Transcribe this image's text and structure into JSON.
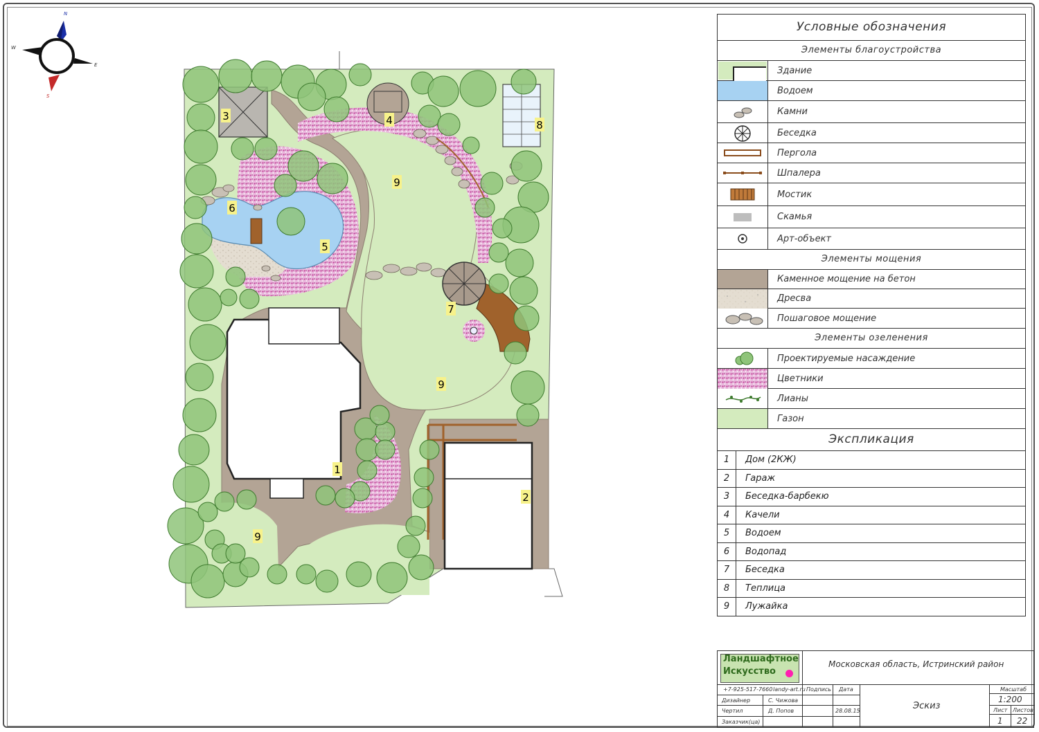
{
  "compass": {
    "n": "N",
    "s": "S",
    "w": "W",
    "e": "E"
  },
  "plan_labels": [
    "1",
    "2",
    "3",
    "4",
    "5",
    "6",
    "7",
    "8",
    "9"
  ],
  "legend": {
    "title": "Условные обозначения",
    "sections": [
      {
        "title": "Элементы благоустройства",
        "items": [
          "Здание",
          "Водоем",
          "Камни",
          "Беседка",
          "Пергола",
          "Шпалера",
          "Мостик",
          "Скамья",
          "Арт-объект"
        ]
      },
      {
        "title": "Элементы мощения",
        "items": [
          "Каменное мощение на бетон",
          "Дресва",
          "Пошаговое мощение"
        ]
      },
      {
        "title": "Элементы озеленения",
        "items": [
          "Проектируемые насаждение",
          "Цветники",
          "Лианы",
          "Газон"
        ]
      }
    ]
  },
  "explication": {
    "title": "Экспликация",
    "items": [
      {
        "num": "1",
        "label": "Дом (2КЖ)"
      },
      {
        "num": "2",
        "label": "Гараж"
      },
      {
        "num": "3",
        "label": "Беседка-барбекю"
      },
      {
        "num": "4",
        "label": "Качели"
      },
      {
        "num": "5",
        "label": "Водоем"
      },
      {
        "num": "6",
        "label": "Водопад"
      },
      {
        "num": "7",
        "label": "Беседка"
      },
      {
        "num": "8",
        "label": "Теплица"
      },
      {
        "num": "9",
        "label": "Лужайка"
      }
    ]
  },
  "title_block": {
    "logo_line1": "Ландшафтное",
    "logo_line2": "Искусство",
    "phone": "+7-925-517-7660",
    "site": "landy-art.ru",
    "location": "Московская область, Истринский район",
    "col_sign": "Подпись",
    "col_date": "Дата",
    "designer_label": "Дизайнер",
    "designer_name": "С. Чижова",
    "drafter_label": "Чертил",
    "drafter_name": "Д. Попов",
    "date": "28.08.15",
    "client_label": "Заказчик(ца)",
    "stage": "Эскиз",
    "scale_label": "Масштаб",
    "scale": "1:200",
    "sheet_label": "Лист",
    "sheets_label": "Листов",
    "sheet": "1",
    "sheets": "22"
  },
  "colors": {
    "lawn": "#d4ebbe",
    "paving": "#b3a495",
    "water": "#a7d2f2",
    "tree": "#8fc47a",
    "flowerbed": "#dba9cf",
    "building": "#ffffff"
  }
}
